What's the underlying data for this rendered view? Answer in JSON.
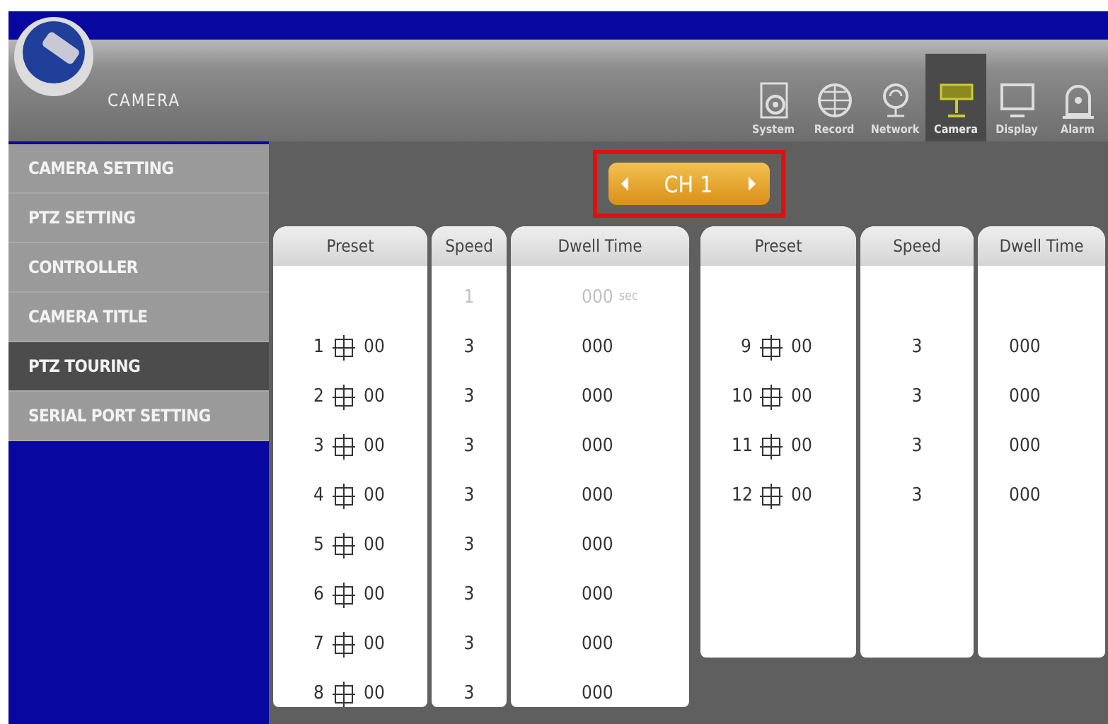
{
  "header": {
    "title": "CAMERA"
  },
  "nav": [
    {
      "label": "System",
      "kind": "system",
      "selected": false
    },
    {
      "label": "Record",
      "kind": "record",
      "selected": false
    },
    {
      "label": "Network",
      "kind": "network",
      "selected": false
    },
    {
      "label": "Camera",
      "kind": "camera",
      "selected": true
    },
    {
      "label": "Display",
      "kind": "display",
      "selected": false
    },
    {
      "label": "Alarm",
      "kind": "alarm",
      "selected": false
    }
  ],
  "sidebar": {
    "items": [
      {
        "label": "CAMERA SETTING",
        "selected": false
      },
      {
        "label": "PTZ SETTING",
        "selected": false
      },
      {
        "label": "CONTROLLER",
        "selected": false
      },
      {
        "label": "CAMERA TITLE",
        "selected": false
      },
      {
        "label": "PTZ TOURING",
        "selected": true
      },
      {
        "label": "SERIAL PORT SETTING",
        "selected": false
      }
    ]
  },
  "channel": {
    "label": "CH 1"
  },
  "tables": [
    {
      "columns": [
        "Preset",
        "Speed",
        "Dwell Time"
      ],
      "default_row": {
        "speed": "1",
        "dwell": "000",
        "unit": "sec"
      },
      "rows": [
        {
          "number": "1",
          "preset": "00",
          "speed": "3",
          "dwell": "000"
        },
        {
          "number": "2",
          "preset": "00",
          "speed": "3",
          "dwell": "000"
        },
        {
          "number": "3",
          "preset": "00",
          "speed": "3",
          "dwell": "000"
        },
        {
          "number": "4",
          "preset": "00",
          "speed": "3",
          "dwell": "000"
        },
        {
          "number": "5",
          "preset": "00",
          "speed": "3",
          "dwell": "000"
        },
        {
          "number": "6",
          "preset": "00",
          "speed": "3",
          "dwell": "000"
        },
        {
          "number": "7",
          "preset": "00",
          "speed": "3",
          "dwell": "000"
        },
        {
          "number": "8",
          "preset": "00",
          "speed": "3",
          "dwell": "000"
        }
      ]
    },
    {
      "columns": [
        "Preset",
        "Speed",
        "Dwell Time"
      ],
      "rows": [
        {
          "number": "9",
          "preset": "00",
          "speed": "3",
          "dwell": "000"
        },
        {
          "number": "10",
          "preset": "00",
          "speed": "3",
          "dwell": "000"
        },
        {
          "number": "11",
          "preset": "00",
          "speed": "3",
          "dwell": "000"
        },
        {
          "number": "12",
          "preset": "00",
          "speed": "3",
          "dwell": "000"
        }
      ]
    }
  ]
}
